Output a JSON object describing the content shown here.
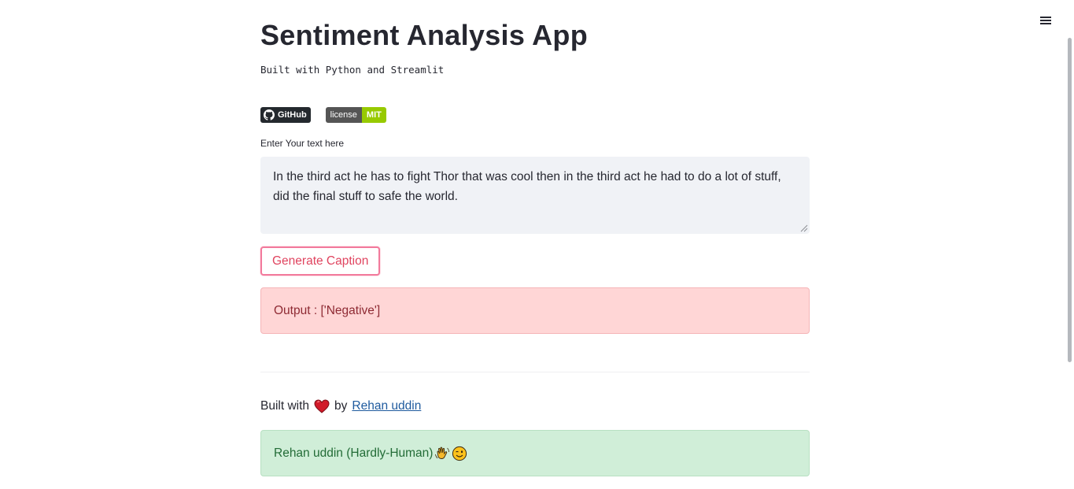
{
  "app": {
    "title": "Sentiment Analysis App",
    "subtitle": "Built with Python and Streamlit"
  },
  "badges": {
    "github_label": "GitHub",
    "license_label": "license",
    "license_value": "MIT",
    "github_color": "#24292e",
    "license_left_color": "#555555",
    "license_right_color": "#97ca00"
  },
  "input": {
    "label": "Enter Your text here",
    "value": "In the third act he has to fight Thor that was cool then in the third act he had to do a lot of stuff, did the final stuff to safe the world."
  },
  "button": {
    "label": "Generate Caption"
  },
  "output": {
    "text": "Output : ['Negative']"
  },
  "footer": {
    "built_with": "Built with",
    "by": "by",
    "author_link": "Rehan uddin",
    "heart_icon": "red-heart-icon"
  },
  "credit": {
    "text": "Rehan uddin (Hardly-Human)",
    "icons": [
      "waving-hand-icon",
      "winking-face-icon"
    ]
  },
  "menu": {
    "icon": "hamburger-menu-icon"
  },
  "colors": {
    "accent": "#f63366",
    "error_bg": "#ffd6d6",
    "success_bg": "#d0eed8",
    "link": "#1e5a9e"
  }
}
